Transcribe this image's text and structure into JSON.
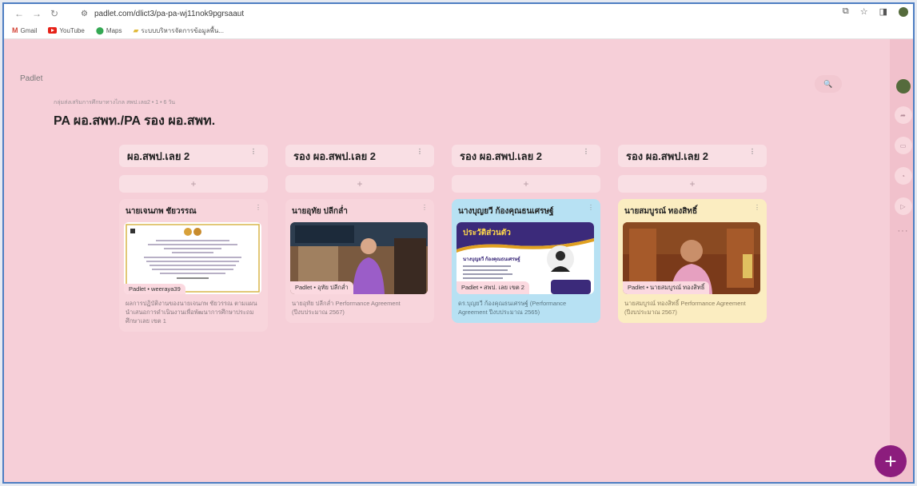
{
  "browser": {
    "url": "padlet.com/dlict3/pa-pa-wj11nok9pgrsaaut",
    "bookmarks": [
      "Gmail",
      "YouTube",
      "Maps",
      "ระบบบริหารจัดการข้อมูลพื้น..."
    ]
  },
  "app": {
    "brand": "Padlet",
    "breadcrumb": "กลุ่มส่งเสริมการศึกษาทางไกล สพป.เลย2 • 1 • 6 วัน",
    "board_title": "PA ผอ.สพท./PA รอง ผอ.สพท."
  },
  "add_post_label": "+",
  "fab_label": "+",
  "columns": [
    {
      "title": "ผอ.สพป.เลย 2",
      "card": {
        "title": "นายเจนภพ ชัยวรรณ",
        "attribution": "Padlet • weeraya39",
        "body": "ผลการปฏิบัติงานของนายเจนภพ ชัยวรรณ ตามแผนนำเสนอการดำเนินงานเพื่อพัฒนาการศึกษาประถมศึกษาเลย เขต 1",
        "color": "#f8d5dc"
      }
    },
    {
      "title": "รอง ผอ.สพป.เลย 2",
      "card": {
        "title": "นายอุทัย ปลีกล่ำ",
        "attribution": "Padlet • อุทัย ปลีกล่ำ",
        "body": "นายอุทัย ปลีกล่ำ Performance Agreement (ปีงบประมาณ 2567)",
        "color": "#f8d5dc"
      }
    },
    {
      "title": "รอง ผอ.สพป.เลย 2",
      "card": {
        "title": "นางบุญยวี ก้องคุณธนเศรษฐ์",
        "attribution": "Padlet • สพป. เลย เขต 2",
        "body": "ดร.บุญยวี ก้องคุณธนเศรษฐ์ (Performance Agreement ปีงบประมาณ 2565)",
        "color": "#b7e1f3",
        "image_heading": "ประวัติส่วนตัว",
        "image_name": "นางบุญยวี ก้องคุณธนเศรษฐ์"
      }
    },
    {
      "title": "รอง ผอ.สพป.เลย 2",
      "card": {
        "title": "นายสมบูรณ์ ทองสิทธิ์",
        "attribution": "Padlet • นายสมบูรณ์ ทองสิทธิ์",
        "body": "นายสมบูรณ์ ทองสิทธิ์ Performance Agreement (ปีงบประมาณ 2567)",
        "color": "#fbedc1"
      }
    }
  ],
  "icons": [
    "back-icon",
    "forward-icon",
    "reload-icon",
    "site-info-icon",
    "cast-icon",
    "star-icon",
    "sidebar-icon",
    "profile-icon",
    "search-icon",
    "share-icon",
    "remake-icon",
    "notifications-icon",
    "slideshow-icon",
    "more-icon",
    "add-icon"
  ]
}
